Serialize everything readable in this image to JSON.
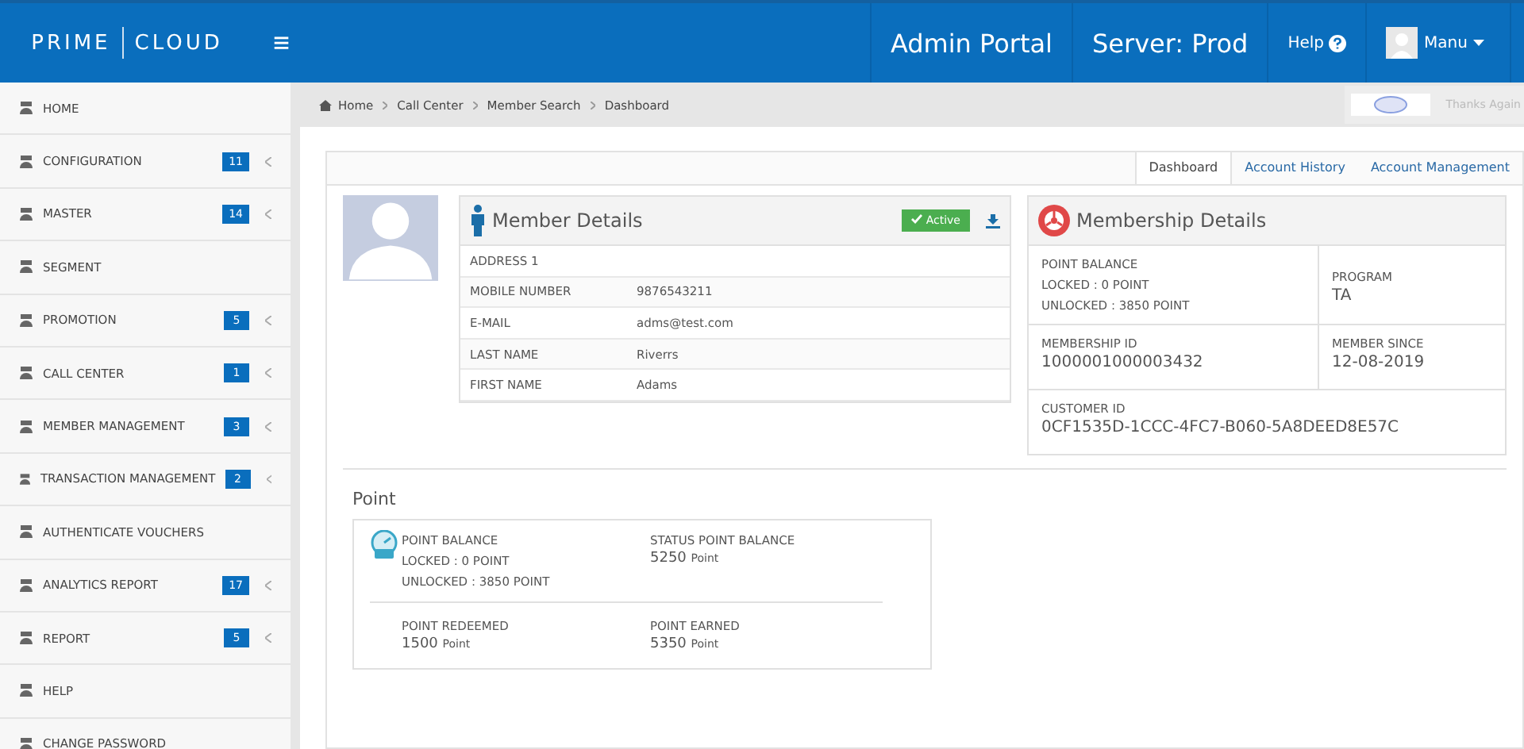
{
  "header": {
    "brand_left": "PRIME",
    "brand_right": "CLOUD",
    "menu_glyph": "≡",
    "portal": "Admin Portal",
    "server": "Server: Prod",
    "help": "Help",
    "user": "Manu"
  },
  "sidebar": {
    "items": [
      {
        "label": "HOME"
      },
      {
        "label": "CONFIGURATION",
        "badge": "11"
      },
      {
        "label": "MASTER",
        "badge": "14"
      },
      {
        "label": "SEGMENT"
      },
      {
        "label": "PROMOTION",
        "badge": "5"
      },
      {
        "label": "CALL CENTER",
        "badge": "1"
      },
      {
        "label": "MEMBER MANAGEMENT",
        "badge": "3"
      },
      {
        "label": "TRANSACTION MANAGEMENT",
        "badge": "2"
      },
      {
        "label": "AUTHENTICATE VOUCHERS"
      },
      {
        "label": "ANALYTICS REPORT",
        "badge": "17"
      },
      {
        "label": "REPORT",
        "badge": "5"
      },
      {
        "label": "HELP"
      },
      {
        "label": "CHANGE PASSWORD"
      }
    ]
  },
  "breadcrumb": [
    "Home",
    "Call Center",
    "Member Search",
    "Dashboard"
  ],
  "partner": {
    "text": "Thanks Again"
  },
  "tabs": [
    {
      "label": "Dashboard",
      "selected": true
    },
    {
      "label": "Account History",
      "selected": false
    },
    {
      "label": "Account Management",
      "selected": false
    }
  ],
  "member_details": {
    "title": "Member Details",
    "status": "Active",
    "active": true,
    "rows": [
      {
        "label": "ADDRESS 1",
        "value": ""
      },
      {
        "label": "MOBILE NUMBER",
        "value": "9876543211"
      },
      {
        "label": "E-MAIL",
        "value": "adms@test.com"
      },
      {
        "label": "LAST NAME",
        "value": "Riverrs"
      },
      {
        "label": "FIRST NAME",
        "value": "Adams"
      }
    ]
  },
  "membership_details": {
    "title": "Membership Details",
    "point_balance": [
      "POINT BALANCE",
      "LOCKED : 0 POINT",
      "UNLOCKED : 3850 POINT"
    ],
    "program": {
      "label": "PROGRAM",
      "value": "TA"
    },
    "membership_id": {
      "label": "MEMBERSHIP ID",
      "value": "1000001000003432"
    },
    "member_since": {
      "label": "MEMBER SINCE",
      "value": "12-08-2019"
    },
    "customer_id": {
      "label": "CUSTOMER ID",
      "value": "0CF1535D-1CCC-4FC7-B060-5A8DEED8E57C"
    }
  },
  "point": {
    "title": "Point",
    "balance": [
      "POINT BALANCE",
      "LOCKED : 0 POINT",
      "UNLOCKED : 3850 POINT"
    ],
    "stats": [
      {
        "label": "STATUS POINT BALANCE",
        "value": "5250",
        "unit": "Point"
      },
      {
        "label": "POINT REDEEMED",
        "value": "1500",
        "unit": "Point"
      },
      {
        "label": "POINT EARNED",
        "value": "5350",
        "unit": "Point"
      }
    ]
  }
}
